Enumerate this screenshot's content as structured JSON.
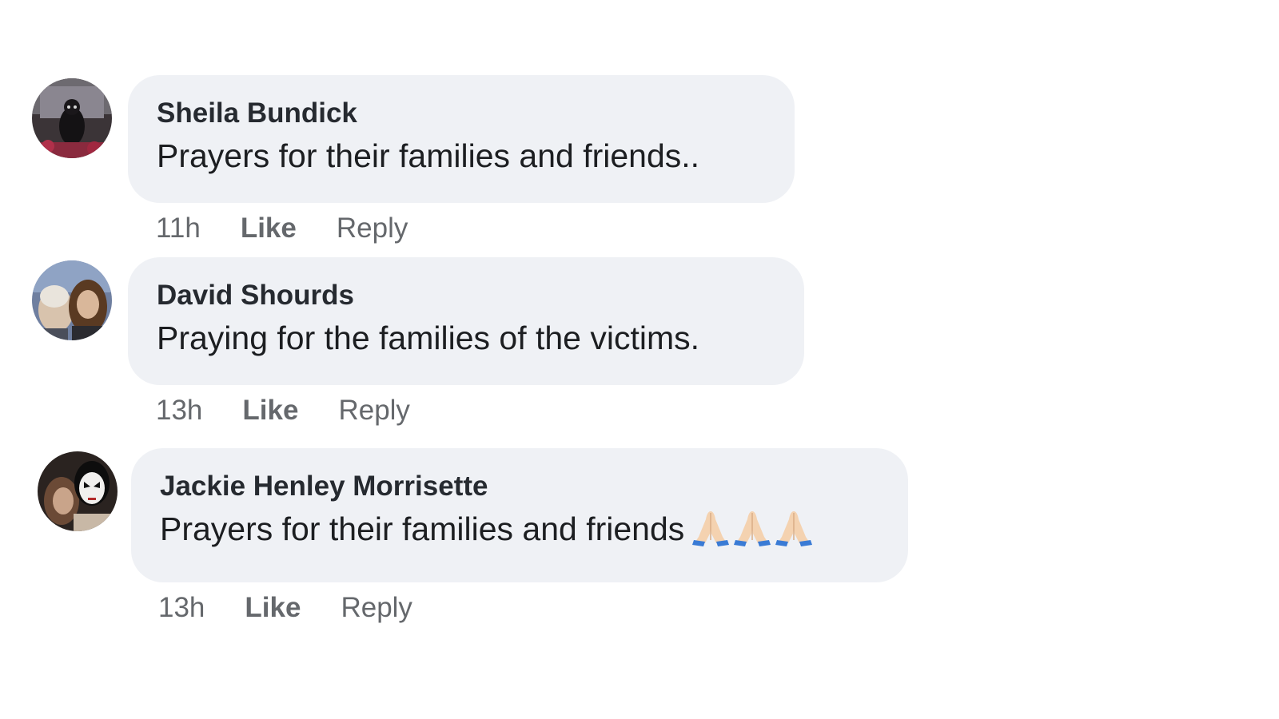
{
  "comments": [
    {
      "author": "Sheila Bundick",
      "text": "Prayers for their families and friends..",
      "time": "11h",
      "like_label": "Like",
      "reply_label": "Reply"
    },
    {
      "author": "David Shourds",
      "text": "Praying for the families of the victims.",
      "time": "13h",
      "like_label": "Like",
      "reply_label": "Reply"
    },
    {
      "author": "Jackie Henley Morrisette",
      "text": "Prayers for their families and friends",
      "emoji": [
        "folded-hands",
        "folded-hands",
        "folded-hands"
      ],
      "time": "13h",
      "like_label": "Like",
      "reply_label": "Reply"
    }
  ],
  "colors": {
    "bubble": "#eff1f5",
    "meta_text": "#65686c",
    "author_text": "#262a30"
  }
}
